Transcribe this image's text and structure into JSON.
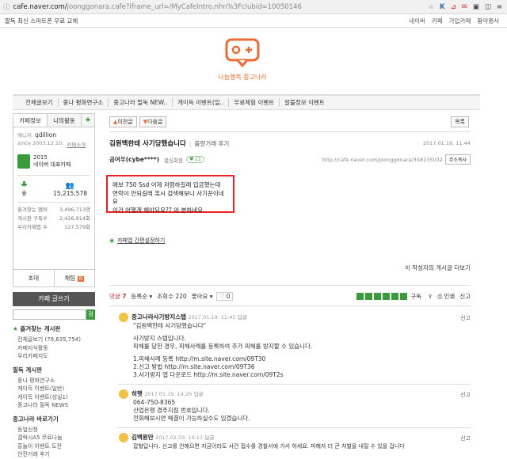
{
  "browser": {
    "url_main": "cafe.naver.com/",
    "url_rest": "joonggonara.cafe?iframe_url=/MyCafeIntro.nhn%3Fclubid=10050146"
  },
  "gnb": {
    "promo": "팔독 최신 스마트폰 무료 교체",
    "links": [
      "네이버",
      "카페",
      "가입카페",
      "황야홍사"
    ]
  },
  "cafe": {
    "name": "나눔행복 중고나라",
    "brand_color": "#ef6b2f"
  },
  "menu": [
    "전체글보기",
    "중나 평화연구소",
    "중고나라 필독 NEW..",
    "게이득 이벤트(일..",
    "무료체험 이벤트",
    "알뜰정보 이벤트"
  ],
  "sidebar": {
    "tabs": [
      "카페정보",
      "나의활동"
    ],
    "manager_label": "매니저",
    "manager_id": "qdillion",
    "since": "since 2003.12.10.",
    "cafe_story": "카페소개",
    "rank_year": "2015",
    "rank_label": "네이버 대표카페",
    "level": "숲",
    "members": "15,215,578",
    "stats": [
      {
        "label": "즐겨찾는 멤버",
        "value": "3,496,713명"
      },
      {
        "label": "게시판 구독수",
        "value": "2,426,914회"
      },
      {
        "label": "우리카페앱 수",
        "value": "127,579회"
      }
    ],
    "invite": "초대",
    "chat": "채팅",
    "write": "카페 글쓰기",
    "search_btn": "검색",
    "fav_title": "즐겨찾는 게시판",
    "fav_items": [
      "전체글보기 (78,635,754)",
      "카페지식활동",
      "우리카페지도"
    ],
    "must_title": "필독 게시판",
    "must_items": [
      "중나 평화연구소",
      "게이득 이벤트(일반)",
      "게이득 이벤트(성실1)",
      "중고나라 필독 NEWS"
    ],
    "shortcut_title": "중고나라 바로가기",
    "shortcut_items": [
      "등업신청",
      "갤럭시A5 무료나눔",
      "흥놀이 이벤트 도전",
      "안전거래 후기"
    ]
  },
  "post": {
    "prev": "이전글",
    "next": "다음글",
    "list": "목록",
    "title": "김원백한테 사기당했습니다",
    "board": "불량거래 후기",
    "date": "2017.01.19. 11:44",
    "author": "곰여우(cybe****)",
    "grade": "열심회원",
    "url": "http://cafe.naver.com/joonggonara/358135032",
    "url_copy": "주소복사",
    "body": [
      "에보 750 Ssd 어제 저렴하길래 입금했는데",
      "연락이 안되길래 혹시 검색해보니 사기꾼이네요",
      "이거 어떻게 해야되요?? 아 분하네요"
    ],
    "safe_link": "카페앱 간편설정하기",
    "more_posts": "이 작성자의 게시글 더보기"
  },
  "comment_bar": {
    "comment_label": "댓글",
    "comment_count": "7",
    "reg_order": "등록순",
    "views_label": "조회수",
    "views": "220",
    "like_label": "좋아요",
    "likes": "0",
    "subscribe": "구독",
    "print": "인쇄",
    "report": "신고"
  },
  "comments": [
    {
      "name": "중고나라사기방지스텝",
      "date": "2017.01.19. 11:45",
      "reply": "답글",
      "report": "신고",
      "lines": [
        "\"김원백한테 사기당했습니다\"",
        "",
        "사기방지 스텝입니다.",
        "피해를 당한 경우, 피해사례를 등록하여 추가 피해를 방지할 수 있습니다.",
        "",
        "1.피해사례 등록 http://m.site.naver.com/09T30",
        "2.신고 방법 http://m.site.naver.com/09T36",
        "3.사기방지 앱 다운로드 http://m.site.naver.com/09T2s"
      ]
    },
    {
      "name": "히햇",
      "date": "2017.01.19. 14:26",
      "reply": "답글",
      "report": "신고",
      "lines": [
        "064-750-8365",
        "산업은행 경주지점 번호입니다.",
        "전화해보시면 해결이 가능하실수도 있겠습니다."
      ]
    },
    {
      "name": "김백원만",
      "date": "2017.02.03. 14:11",
      "reply": "답글",
      "report": "신고",
      "lines": [
        "잡혔답니다. 신고를 안해으면 지금이라도 사건 접수를 경찰서에 가서 하세요. 피해자 더 큰 처벌을 내릴 수 있을 겁니다"
      ]
    }
  ]
}
